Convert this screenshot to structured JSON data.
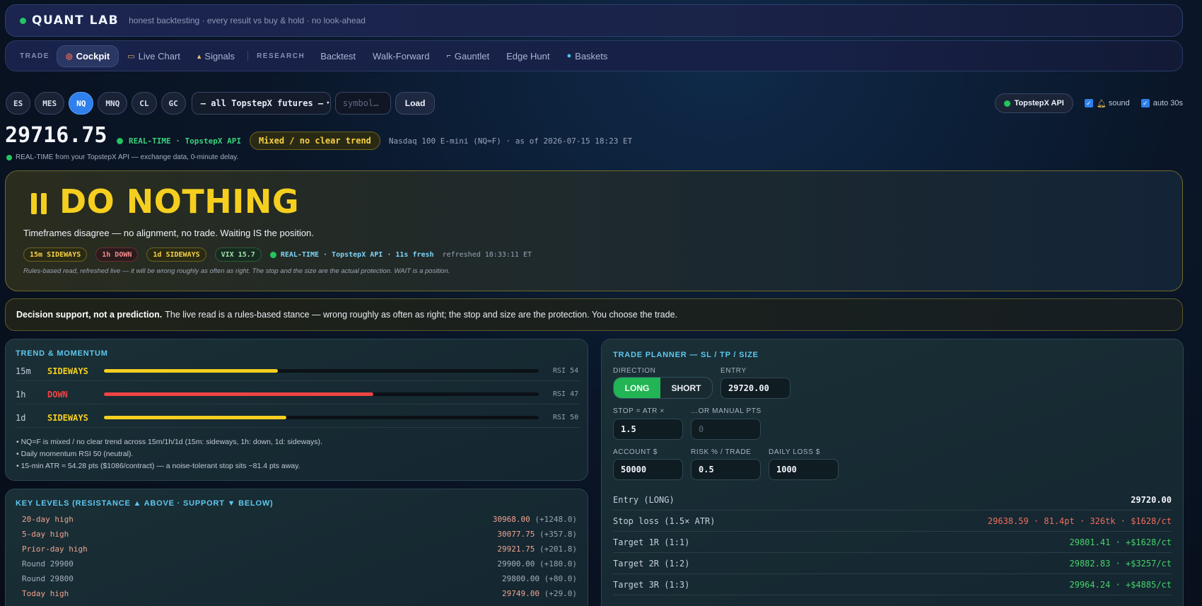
{
  "header": {
    "brand": "QUANT LAB",
    "tagline": "honest backtesting · every result vs buy & hold · no look-ahead"
  },
  "nav": {
    "trade_label": "TRADE",
    "research_label": "RESEARCH",
    "trade_items": [
      {
        "label": "Cockpit",
        "icon": "target-icon"
      },
      {
        "label": "Live Chart",
        "icon": "tv-icon"
      },
      {
        "label": "Signals",
        "icon": "signal-icon"
      }
    ],
    "research_items": [
      {
        "label": "Backtest"
      },
      {
        "label": "Walk-Forward"
      },
      {
        "label": "Gauntlet",
        "icon": "gauntlet-icon"
      },
      {
        "label": "Edge Hunt"
      },
      {
        "label": "Baskets",
        "icon": "globe-icon"
      }
    ]
  },
  "symbols": {
    "items": [
      "ES",
      "MES",
      "NQ",
      "MNQ",
      "CL",
      "GC"
    ],
    "active": "NQ",
    "select_value": "— all TopstepX futures —",
    "input_placeholder": "symbol…",
    "load_label": "Load"
  },
  "controls": {
    "api_label": "TopstepX API",
    "sound_label": "sound",
    "auto_label": "auto 30s"
  },
  "quote": {
    "price": "29716.75",
    "realtime": "REAL-TIME · TopstepX API",
    "trend_badge": "Mixed / no clear trend",
    "as_of": "Nasdaq 100 E-mini (NQ=F) · as of 2026-07-15 18:23 ET",
    "note": "REAL-TIME from your TopstepX API — exchange data, 0-minute delay."
  },
  "hero": {
    "title": "DO NOTHING",
    "subtitle": "Timeframes disagree — no alignment, no trade. Waiting IS the position.",
    "chips": [
      "15m SIDEWAYS",
      "1h DOWN",
      "1d SIDEWAYS",
      "VIX 15.7"
    ],
    "rt": "REAL-TIME · TopstepX API · 11s fresh",
    "refreshed": "refreshed 18:33:11 ET",
    "footnote": "Rules-based read, refreshed live — it will be wrong roughly as often as right. The stop and the size are the actual protection. WAIT is a position."
  },
  "disclaimer": {
    "bold": "Decision support, not a prediction.",
    "text": "The live read is a rules-based stance — wrong roughly as often as right; the stop and size are the protection. You choose the trade."
  },
  "trend": {
    "title": "TREND & MOMENTUM",
    "rows": [
      {
        "tf": "15m",
        "state": "SIDEWAYS",
        "rsi": "RSI 54",
        "strength": 0.4
      },
      {
        "tf": "1h",
        "state": "DOWN",
        "rsi": "RSI 47",
        "strength": 0.62
      },
      {
        "tf": "1d",
        "state": "SIDEWAYS",
        "rsi": "RSI 50",
        "strength": 0.42
      }
    ],
    "notes": [
      "• NQ=F is mixed / no clear trend across 15m/1h/1d (15m: sideways, 1h: down, 1d: sideways).",
      "• Daily momentum RSI 50 (neutral).",
      "• 15-min ATR ≈ 54.28 pts ($1086/contract) — a noise-tolerant stop sits ~81.4 pts away."
    ],
    "colors": {
      "sideways": "#f5cf1f",
      "down": "#ef4444"
    }
  },
  "levels": {
    "title": "KEY LEVELS (RESISTANCE ▲ ABOVE · SUPPORT ▼ BELOW)",
    "rows": [
      {
        "name": "20-day high",
        "value": "30968.00",
        "delta": "(+1248.0)"
      },
      {
        "name": "5-day high",
        "value": "30077.75",
        "delta": "(+357.8)"
      },
      {
        "name": "Prior-day high",
        "value": "29921.75",
        "delta": "(+201.8)"
      },
      {
        "name": "Round 29900",
        "value": "29900.00",
        "delta": "(+180.0)"
      },
      {
        "name": "Round 29800",
        "value": "29800.00",
        "delta": "(+80.0)"
      },
      {
        "name": "Today high",
        "value": "29749.00",
        "delta": "(+29.0)"
      }
    ]
  },
  "planner": {
    "title": "TRADE PLANNER — SL / TP / SIZE",
    "direction_label": "DIRECTION",
    "long_label": "LONG",
    "short_label": "SHORT",
    "entry_label": "ENTRY",
    "entry_value": "29720.00",
    "stop_label": "STOP = ATR ×",
    "stop_value": "1.5",
    "manual_label": "…OR MANUAL PTS",
    "manual_placeholder": "0",
    "account_label": "ACCOUNT $",
    "account_value": "50000",
    "risk_label": "RISK % / TRADE",
    "risk_value": "0.5",
    "daily_label": "DAILY LOSS $",
    "daily_value": "1000",
    "results": [
      {
        "k": "Entry (LONG)",
        "v": "29720.00"
      },
      {
        "k": "Stop loss (1.5× ATR)",
        "v": "29638.59 · 81.4pt · 326tk · $1628/ct"
      },
      {
        "k": "Target 1R (1:1)",
        "v": "29801.41 · +$1628/ct"
      },
      {
        "k": "Target 2R (1:2)",
        "v": "29882.83 · +$3257/ct"
      },
      {
        "k": "Target 3R (1:3)",
        "v": "29964.24 · +$4885/ct"
      }
    ]
  }
}
